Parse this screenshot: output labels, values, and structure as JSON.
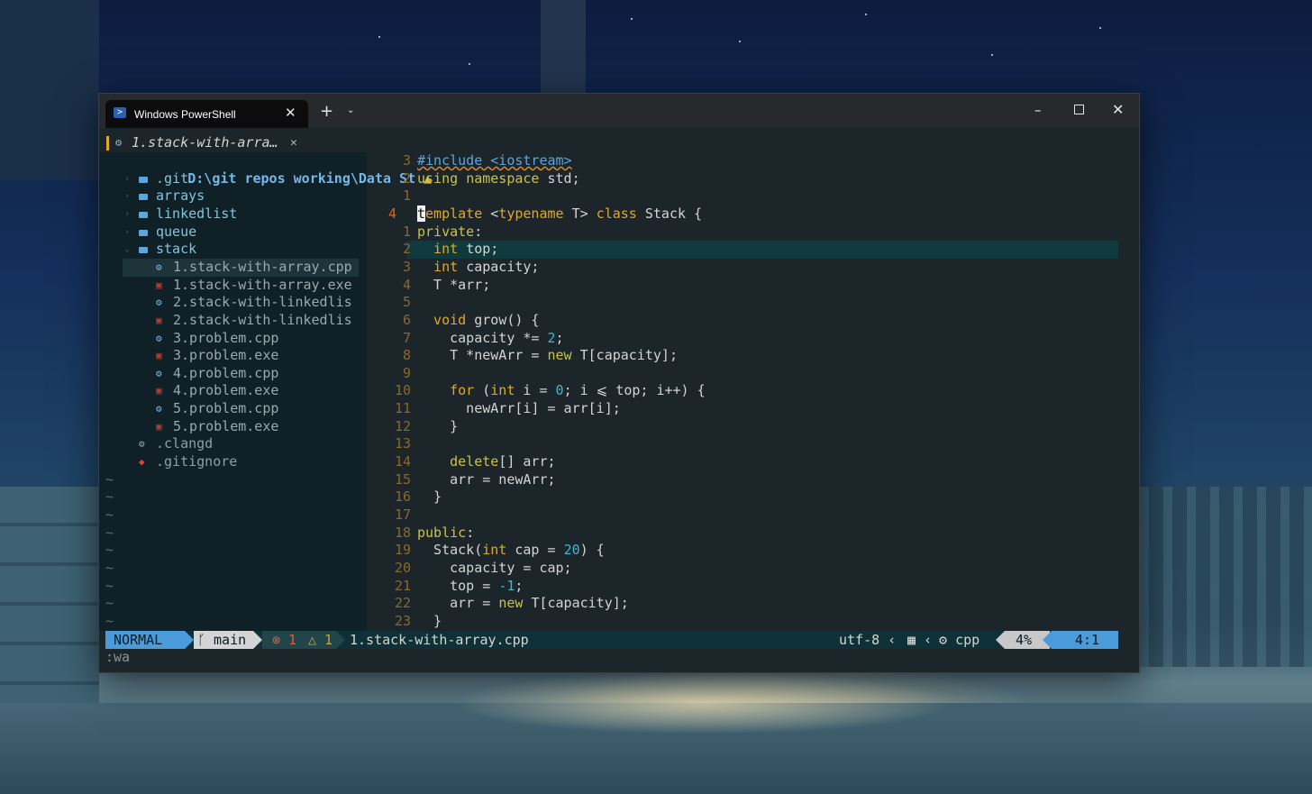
{
  "window": {
    "tab_title": "Windows PowerShell",
    "tab_close": "✕",
    "new_tab": "+",
    "dropdown": "⌄",
    "minimize": "–",
    "close": "✕"
  },
  "buffer": {
    "name": "1.stack-with-arra…",
    "close": "✕"
  },
  "explorer": {
    "root": "D:\\git repos working\\Data St",
    "root_warning": "▲",
    "items": [
      {
        "label": ".git",
        "kind": "folder"
      },
      {
        "label": "arrays",
        "kind": "folder"
      },
      {
        "label": "linkedlist",
        "kind": "folder"
      },
      {
        "label": "queue",
        "kind": "folder"
      },
      {
        "label": "stack",
        "kind": "folder-open"
      },
      {
        "label": "1.stack-with-array.cpp",
        "kind": "cpp"
      },
      {
        "label": "1.stack-with-array.exe",
        "kind": "exe"
      },
      {
        "label": "2.stack-with-linkedlis",
        "kind": "cpp"
      },
      {
        "label": "2.stack-with-linkedlis",
        "kind": "exe"
      },
      {
        "label": "3.problem.cpp",
        "kind": "cpp"
      },
      {
        "label": "3.problem.exe",
        "kind": "exe"
      },
      {
        "label": "4.problem.cpp",
        "kind": "cpp"
      },
      {
        "label": "4.problem.exe",
        "kind": "exe"
      },
      {
        "label": "5.problem.cpp",
        "kind": "cpp"
      },
      {
        "label": "5.problem.exe",
        "kind": "exe"
      },
      {
        "label": ".clangd",
        "kind": "config"
      },
      {
        "label": ".gitignore",
        "kind": "git"
      }
    ],
    "selected_index": 5
  },
  "editor": {
    "line_numbers": [
      "3",
      "2",
      "1",
      "4",
      "1",
      "2",
      "3",
      "4",
      "5",
      "6",
      "7",
      "8",
      "9",
      "10",
      "11",
      "12",
      "13",
      "14",
      "15",
      "16",
      "17",
      "18",
      "19",
      "20",
      "21",
      "22",
      "23"
    ],
    "current_line_index": 3,
    "lines": [
      [
        {
          "t": "#include <iostream>",
          "c": "inc"
        }
      ],
      [
        {
          "t": "using ",
          "c": "kw2"
        },
        {
          "t": "namespace ",
          "c": "kw2"
        },
        {
          "t": "std;",
          "c": "tp"
        }
      ],
      [],
      [
        {
          "t": "t",
          "c": "cursor"
        },
        {
          "t": "emplate ",
          "c": "kw"
        },
        {
          "t": "<",
          "c": "tp"
        },
        {
          "t": "typename ",
          "c": "kw"
        },
        {
          "t": "T> ",
          "c": "tp"
        },
        {
          "t": "class ",
          "c": "kw"
        },
        {
          "t": "Stack {",
          "c": "tp"
        }
      ],
      [
        {
          "t": "private",
          "c": "kw2"
        },
        {
          "t": ":",
          "c": "tp"
        }
      ],
      [
        {
          "t": "  int ",
          "c": "kw"
        },
        {
          "t": "top;",
          "c": "tp"
        }
      ],
      [
        {
          "t": "  int ",
          "c": "kw"
        },
        {
          "t": "capacity;",
          "c": "tp"
        }
      ],
      [
        {
          "t": "  T *arr;",
          "c": "tp"
        }
      ],
      [],
      [
        {
          "t": "  void ",
          "c": "kw"
        },
        {
          "t": "grow() {",
          "c": "tp"
        }
      ],
      [
        {
          "t": "    capacity *= ",
          "c": "tp"
        },
        {
          "t": "2",
          "c": "num"
        },
        {
          "t": ";",
          "c": "tp"
        }
      ],
      [
        {
          "t": "    T *newArr = ",
          "c": "tp"
        },
        {
          "t": "new ",
          "c": "kw2"
        },
        {
          "t": "T[capacity];",
          "c": "tp"
        }
      ],
      [],
      [
        {
          "t": "    for ",
          "c": "kw"
        },
        {
          "t": "(",
          "c": "tp"
        },
        {
          "t": "int ",
          "c": "kw"
        },
        {
          "t": "i = ",
          "c": "tp"
        },
        {
          "t": "0",
          "c": "num"
        },
        {
          "t": "; i ⩽ top; i++) {",
          "c": "tp"
        }
      ],
      [
        {
          "t": "      newArr[i] = arr[i];",
          "c": "tp"
        }
      ],
      [
        {
          "t": "    }",
          "c": "tp"
        }
      ],
      [],
      [
        {
          "t": "    delete",
          "c": "kw2"
        },
        {
          "t": "[] arr;",
          "c": "tp"
        }
      ],
      [
        {
          "t": "    arr = newArr;",
          "c": "tp"
        }
      ],
      [
        {
          "t": "  }",
          "c": "tp"
        }
      ],
      [],
      [
        {
          "t": "public",
          "c": "kw2"
        },
        {
          "t": ":",
          "c": "tp"
        }
      ],
      [
        {
          "t": "  Stack(",
          "c": "tp"
        },
        {
          "t": "int ",
          "c": "kw"
        },
        {
          "t": "cap = ",
          "c": "tp"
        },
        {
          "t": "20",
          "c": "num"
        },
        {
          "t": ") {",
          "c": "tp"
        }
      ],
      [
        {
          "t": "    capacity = cap;",
          "c": "tp"
        }
      ],
      [
        {
          "t": "    top = ",
          "c": "tp"
        },
        {
          "t": "-1",
          "c": "num"
        },
        {
          "t": ";",
          "c": "tp"
        }
      ],
      [
        {
          "t": "    arr = ",
          "c": "tp"
        },
        {
          "t": "new ",
          "c": "kw2"
        },
        {
          "t": "T[capacity];",
          "c": "tp"
        }
      ],
      [
        {
          "t": "  }",
          "c": "tp"
        }
      ]
    ]
  },
  "statusline": {
    "mode": "NORMAL",
    "branch": "ᚴ main",
    "errors": "⊗ 1",
    "warnings": "△ 1",
    "filename": "1.stack-with-array.cpp",
    "encoding": "utf-8",
    "os_icon": "▦",
    "filetype": "cpp",
    "percent": "4%",
    "position": "4:1"
  },
  "cmdline": ":wa",
  "colors": {
    "accent": "#4a9bd9",
    "keyword": "#e0a928",
    "number": "#3fb9c9",
    "error": "#e05a3a"
  }
}
